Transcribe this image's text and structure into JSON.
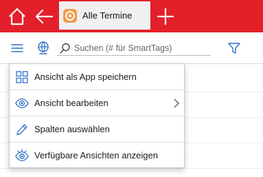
{
  "topbar": {
    "accent_color": "#e3202a",
    "home_icon": "home-icon",
    "back_icon": "arrow-left-icon",
    "add_icon": "plus-icon",
    "tab": {
      "label": "Alle Termine",
      "icon": "calendar-app-icon"
    }
  },
  "toolbar": {
    "menu_icon": "hamburger-icon",
    "views_icon": "globe-icon",
    "filter_icon": "filter-icon",
    "search": {
      "placeholder": "Suchen (# für SmartTags)",
      "value": ""
    }
  },
  "menu": {
    "items": [
      {
        "label": "Ansicht als App speichern",
        "icon": "grid-icon"
      },
      {
        "label": "Ansicht bearbeiten",
        "icon": "eye-icon",
        "has_submenu": true
      },
      {
        "label": "Spalten auswählen",
        "icon": "pencil-icon"
      },
      {
        "label": "Verfügbare Ansichten anzeigen",
        "icon": "eye-gear-icon"
      }
    ]
  }
}
